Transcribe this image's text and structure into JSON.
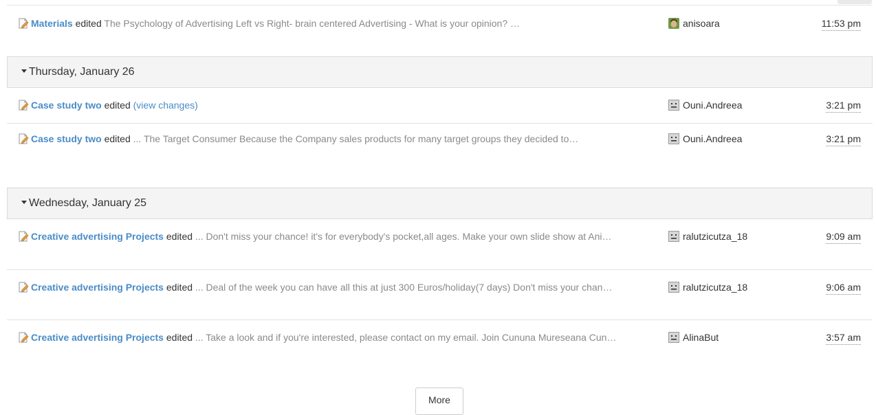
{
  "entries_top": [
    {
      "page": "Materials",
      "verb": "edited",
      "excerpt": "The Psychology of Advertising Left vs Right- brain centered Advertising - What is your opinion? …",
      "link": "",
      "user": "anisoara",
      "avatar": "photo-avatar",
      "time": "11:53 pm"
    }
  ],
  "days": [
    {
      "label": "Thursday, January 26",
      "entries": [
        {
          "page": "Case study two",
          "verb": "edited",
          "excerpt": "",
          "link": "(view changes)",
          "user": "Ouni.Andreea",
          "avatar": "default-avatar-icon",
          "time": "3:21 pm"
        },
        {
          "page": "Case study two",
          "verb": "edited",
          "excerpt": "... The Target Consumer Because the Company sales products for many target groups they decided to…",
          "link": "",
          "user": "Ouni.Andreea",
          "avatar": "default-avatar-icon",
          "time": "3:21 pm"
        }
      ]
    },
    {
      "label": "Wednesday, January 25",
      "entries": [
        {
          "page": "Creative advertising Projects",
          "verb": "edited",
          "excerpt": "... Don't miss your chance! it's for everybody's pocket,all ages. Make your own slide show at Ani…",
          "link": "",
          "user": "ralutzicutza_18",
          "avatar": "default-avatar-icon",
          "time": "9:09 am"
        },
        {
          "page": "Creative advertising Projects",
          "verb": "edited",
          "excerpt": "... Deal of the week you can have all this at just 300 Euros/holiday(7 days) Don't miss your chan…",
          "link": "",
          "user": "ralutzicutza_18",
          "avatar": "default-avatar-icon",
          "time": "9:06 am"
        },
        {
          "page": "Creative advertising Projects",
          "verb": "edited",
          "excerpt": "... Take a look and if you're interested, please contact on my email. Join Cununa Mureseana Cun…",
          "link": "",
          "user": "AlinaBut",
          "avatar": "default-avatar-icon",
          "time": "3:57 am"
        }
      ]
    }
  ],
  "more_label": "More",
  "colors": {
    "link": "#4a8cc7",
    "excerpt": "#8a8a8a",
    "header_bg": "#f4f4f4"
  }
}
